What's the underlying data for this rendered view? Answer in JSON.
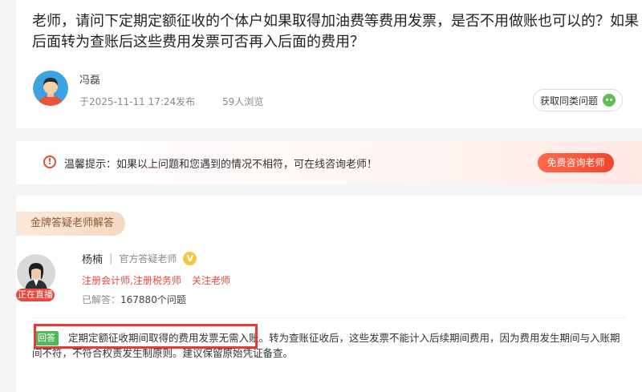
{
  "question": {
    "text": "老师，请问下定期定额征收的个体户如果取得加油费等费用发票，是否不用做账也可以的？如果后面转为查账后这些费用发票可否再入后面的费用？",
    "asker_name": "冯磊",
    "posted": "于2025-11-11  17:24发布",
    "views": "59人浏览",
    "similar_button": "获取同类问题"
  },
  "tip": {
    "text": "温馨提示：如果以上问题和您遇到的情况不相符，可在线咨询老师！",
    "consult_button": "免费咨询老师"
  },
  "answer": {
    "section_tag": "金牌答疑老师解答",
    "teacher_name": "杨楠",
    "teacher_role": "官方答疑老师",
    "v_badge": "V",
    "certs": "注册会计师,注册税务师",
    "follow": "关注老师",
    "answered_label": "已解答：",
    "answered_count": "167880个问题",
    "live_badge": "正在直播",
    "answer_tag": "回答",
    "body": "定期定额征收期间取得的费用发票无需入账。转为查账征收后，这些发票不能计入后续期间费用，因为费用发生期间与入账期间不符，不符合权责发生制原则。建议保留原始凭证备查。"
  },
  "colors": {
    "accent_red": "#e8493a",
    "answer_green": "#4fb85a",
    "highlight_border": "#e53a3a"
  }
}
